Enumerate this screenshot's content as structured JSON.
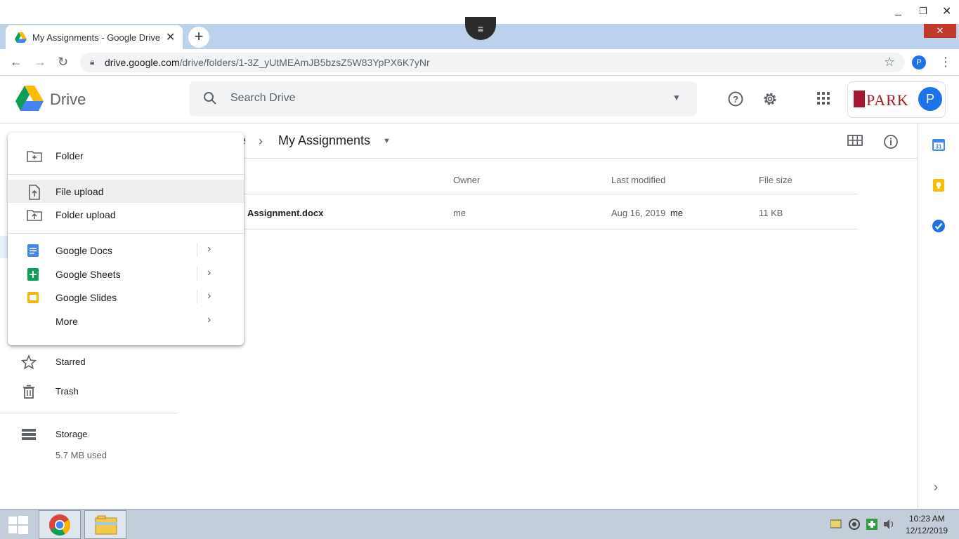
{
  "browser": {
    "tab_title": "My Assignments - Google Drive",
    "tab_close": "✕",
    "new_tab": "+",
    "url_host": "drive.google.com",
    "url_path": "/drive/folders/1-3Z_yUtMEAmJB5bzsZ5W83YpPX6K7yNr",
    "profile_initial": "P",
    "menu_glyph": "≡"
  },
  "drive": {
    "app_name": "Drive",
    "search_placeholder": "Search Drive",
    "org_name": "PARK",
    "avatar_initial": "P",
    "breadcrumb_clipped": "e",
    "folder_title": "My Assignments"
  },
  "left_nav": {
    "items": [
      {
        "label": "Starred",
        "icon": "star-icon"
      },
      {
        "label": "Trash",
        "icon": "trash-icon"
      },
      {
        "label": "Storage",
        "icon": "storage-icon"
      }
    ],
    "storage_used": "5.7 MB used"
  },
  "new_menu": {
    "items": [
      {
        "label": "Folder",
        "icon": "new-folder-icon"
      },
      {
        "label": "File upload",
        "icon": "file-upload-icon"
      },
      {
        "label": "Folder upload",
        "icon": "folder-upload-icon"
      },
      {
        "label": "Google Docs",
        "icon": "docs-icon"
      },
      {
        "label": "Google Sheets",
        "icon": "sheets-icon"
      },
      {
        "label": "Google Slides",
        "icon": "slides-icon"
      },
      {
        "label": "More",
        "icon": ""
      }
    ]
  },
  "file_list": {
    "columns": [
      "Owner",
      "Last modified",
      "File size"
    ],
    "rows": [
      {
        "name": "Assignment.docx",
        "owner": "me",
        "modified_date": "Aug 16, 2019",
        "modified_by": "me",
        "size": "11 KB"
      }
    ]
  },
  "taskbar": {
    "time": "10:23 AM",
    "date": "12/12/2019"
  },
  "colors": {
    "accent": "#1a73e8",
    "tabstrip": "#bcd2ec",
    "brand_red": "#a3192b"
  }
}
